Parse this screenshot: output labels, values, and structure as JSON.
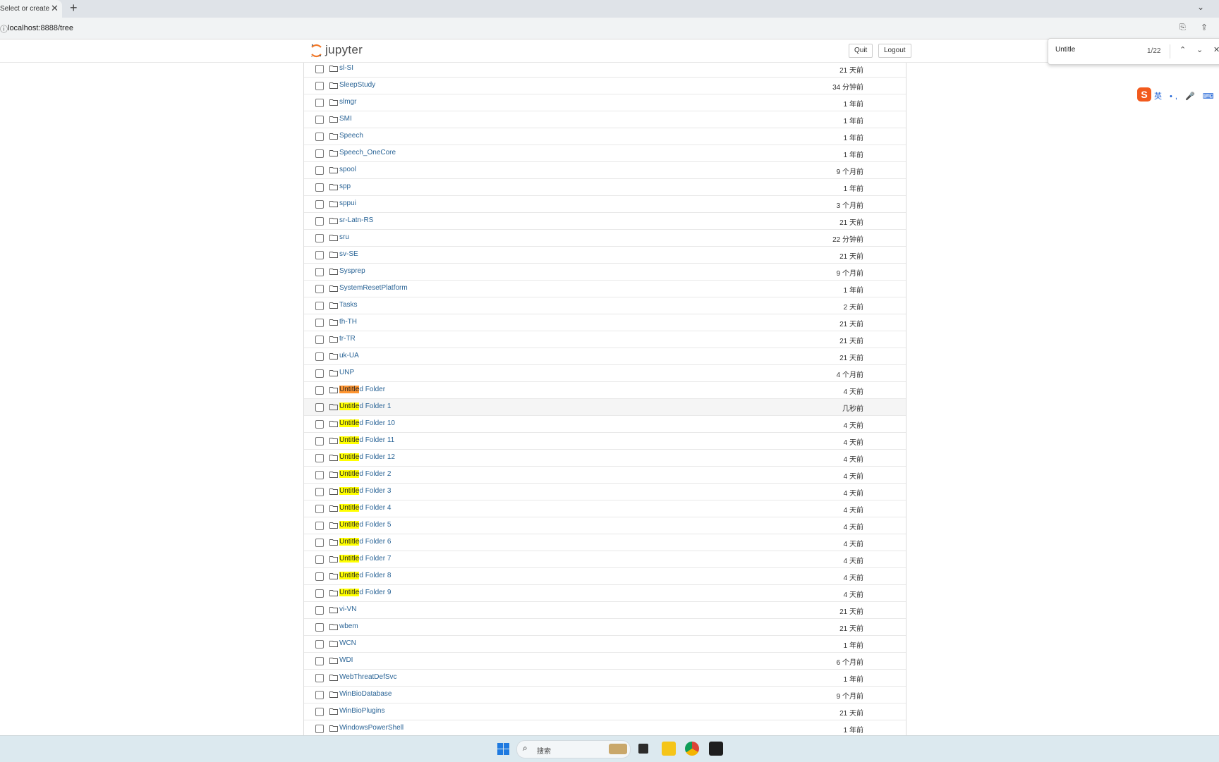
{
  "browser": {
    "tab_title": "Select or create",
    "tab_close": "✕",
    "new_tab": "+",
    "tab_dropdown": "⌄",
    "url": "localhost:8888/tree",
    "address_actions": "⎘ ⇪ ☆"
  },
  "find_bar": {
    "query": "Untitle",
    "count": "1/22",
    "prev": "⌃",
    "next": "⌄",
    "close": "✕"
  },
  "jupyter": {
    "logo_text": "jupyter",
    "quit_label": "Quit",
    "logout_label": "Logout"
  },
  "ime": {
    "logo": "S",
    "text": "英 •, 🎤 ⌨ 👕"
  },
  "search_query": "Untitle",
  "files": [
    {
      "name": "sl-SI",
      "modified": "21 天前"
    },
    {
      "name": "SleepStudy",
      "modified": "34 分钟前"
    },
    {
      "name": "slmgr",
      "modified": "1 年前"
    },
    {
      "name": "SMI",
      "modified": "1 年前"
    },
    {
      "name": "Speech",
      "modified": "1 年前"
    },
    {
      "name": "Speech_OneCore",
      "modified": "1 年前"
    },
    {
      "name": "spool",
      "modified": "9 个月前"
    },
    {
      "name": "spp",
      "modified": "1 年前"
    },
    {
      "name": "sppui",
      "modified": "3 个月前"
    },
    {
      "name": "sr-Latn-RS",
      "modified": "21 天前"
    },
    {
      "name": "sru",
      "modified": "22 分钟前"
    },
    {
      "name": "sv-SE",
      "modified": "21 天前"
    },
    {
      "name": "Sysprep",
      "modified": "9 个月前"
    },
    {
      "name": "SystemResetPlatform",
      "modified": "1 年前"
    },
    {
      "name": "Tasks",
      "modified": "2 天前"
    },
    {
      "name": "th-TH",
      "modified": "21 天前"
    },
    {
      "name": "tr-TR",
      "modified": "21 天前"
    },
    {
      "name": "uk-UA",
      "modified": "21 天前"
    },
    {
      "name": "UNP",
      "modified": "4 个月前"
    },
    {
      "name": "Untitled Folder",
      "modified": "4 天前"
    },
    {
      "name": "Untitled Folder 1",
      "modified": "几秒前"
    },
    {
      "name": "Untitled Folder 10",
      "modified": "4 天前"
    },
    {
      "name": "Untitled Folder 11",
      "modified": "4 天前"
    },
    {
      "name": "Untitled Folder 12",
      "modified": "4 天前"
    },
    {
      "name": "Untitled Folder 2",
      "modified": "4 天前"
    },
    {
      "name": "Untitled Folder 3",
      "modified": "4 天前"
    },
    {
      "name": "Untitled Folder 4",
      "modified": "4 天前"
    },
    {
      "name": "Untitled Folder 5",
      "modified": "4 天前"
    },
    {
      "name": "Untitled Folder 6",
      "modified": "4 天前"
    },
    {
      "name": "Untitled Folder 7",
      "modified": "4 天前"
    },
    {
      "name": "Untitled Folder 8",
      "modified": "4 天前"
    },
    {
      "name": "Untitled Folder 9",
      "modified": "4 天前"
    },
    {
      "name": "vi-VN",
      "modified": "21 天前"
    },
    {
      "name": "wbem",
      "modified": "21 天前"
    },
    {
      "name": "WCN",
      "modified": "1 年前"
    },
    {
      "name": "WDI",
      "modified": "6 个月前"
    },
    {
      "name": "WebThreatDefSvc",
      "modified": "1 年前"
    },
    {
      "name": "WinBioDatabase",
      "modified": "9 个月前"
    },
    {
      "name": "WinBioPlugins",
      "modified": "21 天前"
    },
    {
      "name": "WindowsPowerShell",
      "modified": "1 年前"
    }
  ],
  "current_match_index": 19,
  "hover_index": 20,
  "taskbar": {
    "search_placeholder": "搜索",
    "search_icon": "⌕"
  }
}
